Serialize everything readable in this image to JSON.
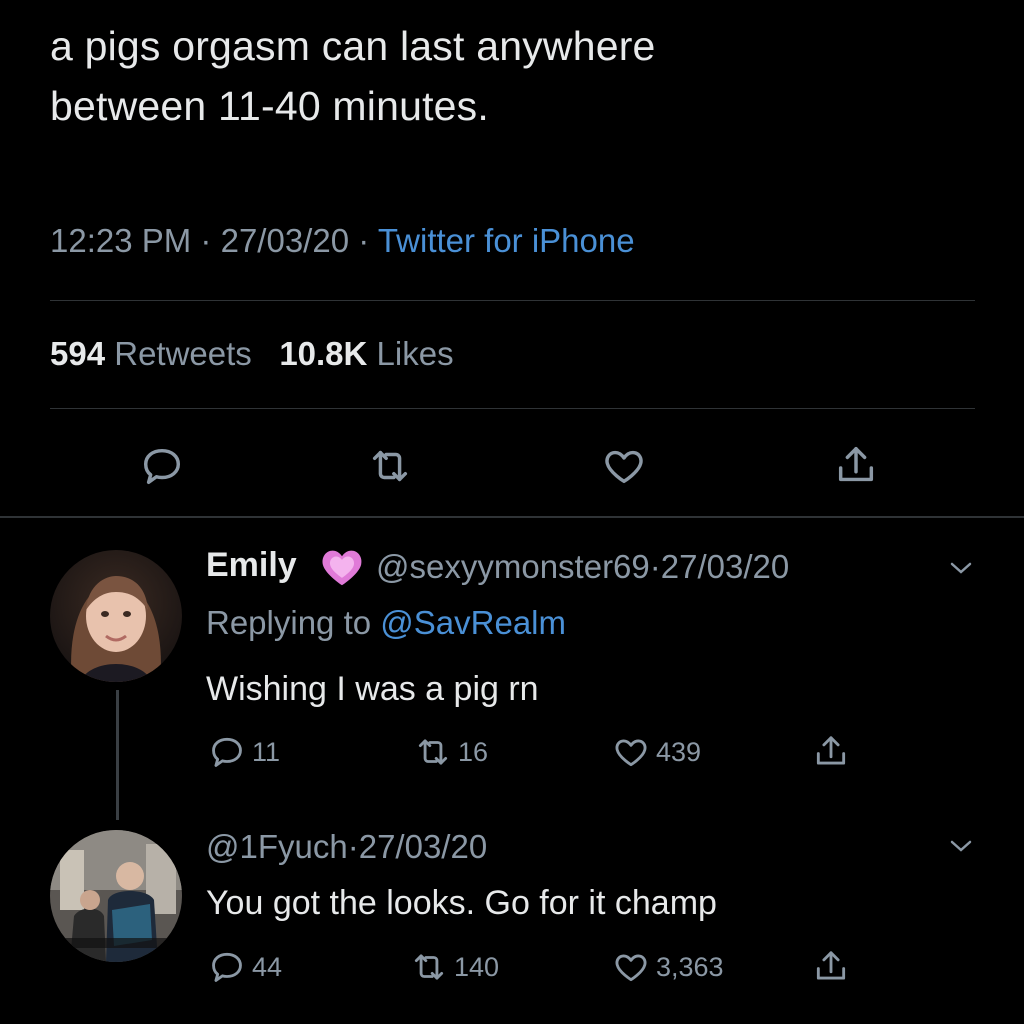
{
  "tweet": {
    "text_line1": "a pigs orgasm can last anywhere",
    "text_line2": "between 11-40 minutes.",
    "time": "12:23 PM",
    "date": "27/03/20",
    "source": "Twitter for iPhone",
    "sep": "·",
    "retweets_count": "594",
    "retweets_label": "Retweets",
    "likes_count": "10.8K",
    "likes_label": "Likes"
  },
  "actions": {
    "reply_icon": "reply-icon",
    "retweet_icon": "retweet-icon",
    "like_icon": "heart-icon",
    "share_icon": "share-icon"
  },
  "replies": [
    {
      "name": "Emily",
      "emoji": "💗",
      "handle": "@sexyymonster69",
      "date": "27/03/20",
      "replying_prefix": "Replying to",
      "replying_to": "@SavRealm",
      "text": "Wishing I was a pig rn",
      "reply_count": "11",
      "retweet_count": "16",
      "like_count": "439"
    },
    {
      "handle": "@1Fyuch",
      "date": "27/03/20",
      "text": "You got the looks. Go for it champ",
      "reply_count": "44",
      "retweet_count": "140",
      "like_count": "3,363"
    }
  ],
  "colors": {
    "background": "#000000",
    "text": "#e7e9ea",
    "muted": "#8b98a5",
    "link": "#4a90d6",
    "divider": "#2f3336",
    "heart_emoji": "#e07ad8"
  }
}
